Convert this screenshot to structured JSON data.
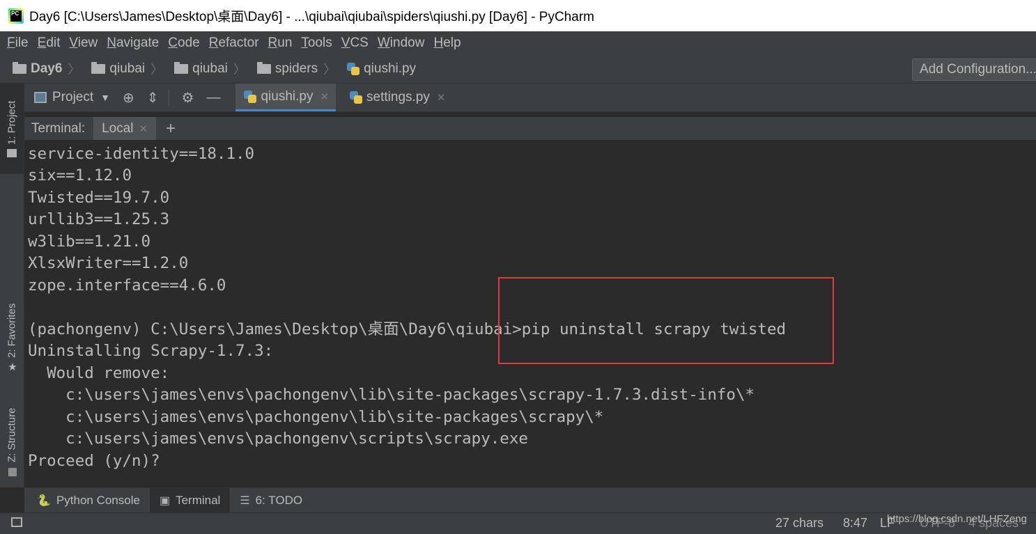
{
  "window": {
    "title": "Day6 [C:\\Users\\James\\Desktop\\桌面\\Day6] - ...\\qiubai\\qiubai\\spiders\\qiushi.py [Day6] - PyCharm"
  },
  "menu": [
    "File",
    "Edit",
    "View",
    "Navigate",
    "Code",
    "Refactor",
    "Run",
    "Tools",
    "VCS",
    "Window",
    "Help"
  ],
  "breadcrumb": [
    "Day6",
    "qiubai",
    "qiubai",
    "spiders",
    "qiushi.py"
  ],
  "add_configuration": "Add Configuration...",
  "left_strip": {
    "project": "1: Project",
    "favorites": "2: Favorites",
    "structure": "Z: Structure"
  },
  "toolwindow": {
    "project_label": "Project",
    "tabs": [
      {
        "label": "qiushi.py",
        "active": true
      },
      {
        "label": "settings.py",
        "active": false
      }
    ]
  },
  "terminal": {
    "label": "Terminal:",
    "session": "Local",
    "lines": [
      "service-identity==18.1.0",
      "six==1.12.0",
      "Twisted==19.7.0",
      "urllib3==1.25.3",
      "w3lib==1.21.0",
      "XlsxWriter==1.2.0",
      "zope.interface==4.6.0",
      "",
      "(pachongenv) C:\\Users\\James\\Desktop\\桌面\\Day6\\qiubai>pip uninstall scrapy twisted",
      "Uninstalling Scrapy-1.7.3:",
      "  Would remove:",
      "    c:\\users\\james\\envs\\pachongenv\\lib\\site-packages\\scrapy-1.7.3.dist-info\\*",
      "    c:\\users\\james\\envs\\pachongenv\\lib\\site-packages\\scrapy\\*",
      "    c:\\users\\james\\envs\\pachongenv\\scripts\\scrapy.exe",
      "Proceed (y/n)?"
    ]
  },
  "bottom_tabs": [
    {
      "label": "Python Console",
      "active": false
    },
    {
      "label": "Terminal",
      "active": true
    },
    {
      "label": "6: TODO",
      "active": false
    }
  ],
  "status": {
    "chars": "27 chars",
    "position": "8:47",
    "line_sep": "LF",
    "encoding": "UTF-8",
    "indent": "4 spaces",
    "watermark": "https://blog.csdn.net/LHFZeng"
  },
  "colors": {
    "highlight_box": "#e03c3c",
    "active_tab_underline": "#4a88c7",
    "background": "#2b2b2b",
    "panel": "#3c3f41"
  }
}
